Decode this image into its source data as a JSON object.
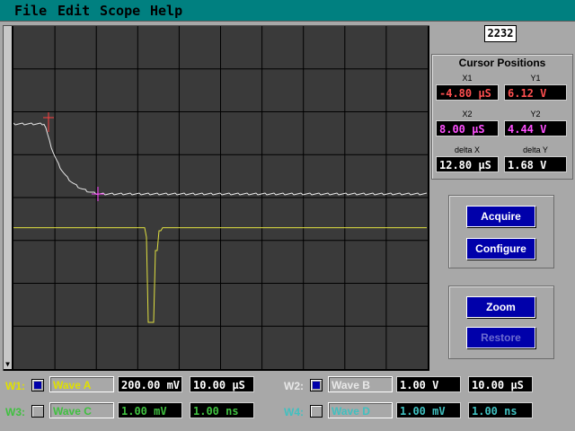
{
  "menu": [
    "File",
    "Edit",
    "Scope",
    "Help"
  ],
  "counter": "2232",
  "cursor_panel": {
    "title": "Cursor Positions",
    "x1_label": "X1",
    "x1_value": "-4.80 µS",
    "y1_label": "Y1",
    "y1_value": "6.12 V",
    "x2_label": "X2",
    "x2_value": "8.00 µS",
    "y2_label": "Y2",
    "y2_value": "4.44 V",
    "dx_label": "delta X",
    "dx_value": "12.80 µS",
    "dy_label": "delta Y",
    "dy_value": "1.68 V"
  },
  "buttons": {
    "acquire": "Acquire",
    "configure": "Configure",
    "zoom": "Zoom",
    "restore": "Restore"
  },
  "waves": {
    "w1": {
      "label": "W1:",
      "enabled": true,
      "name": "Wave A",
      "volts": "200.00 mV",
      "time": "10.00 µS"
    },
    "w2": {
      "label": "W2:",
      "enabled": true,
      "name": "Wave B",
      "volts": "1.00 V",
      "time": "10.00 µS"
    },
    "w3": {
      "label": "W3:",
      "enabled": false,
      "name": "Wave C",
      "volts": "1.00 mV",
      "time": "1.00 ns"
    },
    "w4": {
      "label": "W4:",
      "enabled": false,
      "name": "Wave D",
      "volts": "1.00 mV",
      "time": "1.00 ns"
    }
  },
  "colors": {
    "trace_white": "#e8e8e8",
    "trace_yellow": "#e0e040",
    "cursor1": "#ff4040",
    "cursor2": "#ff40ff",
    "w1_label": "#e0e000",
    "w2_label": "#e8e8e8",
    "w3_label": "#40c040",
    "w4_label": "#40c0c0"
  },
  "icons": {
    "scroll_down": "triangle-down-icon"
  }
}
